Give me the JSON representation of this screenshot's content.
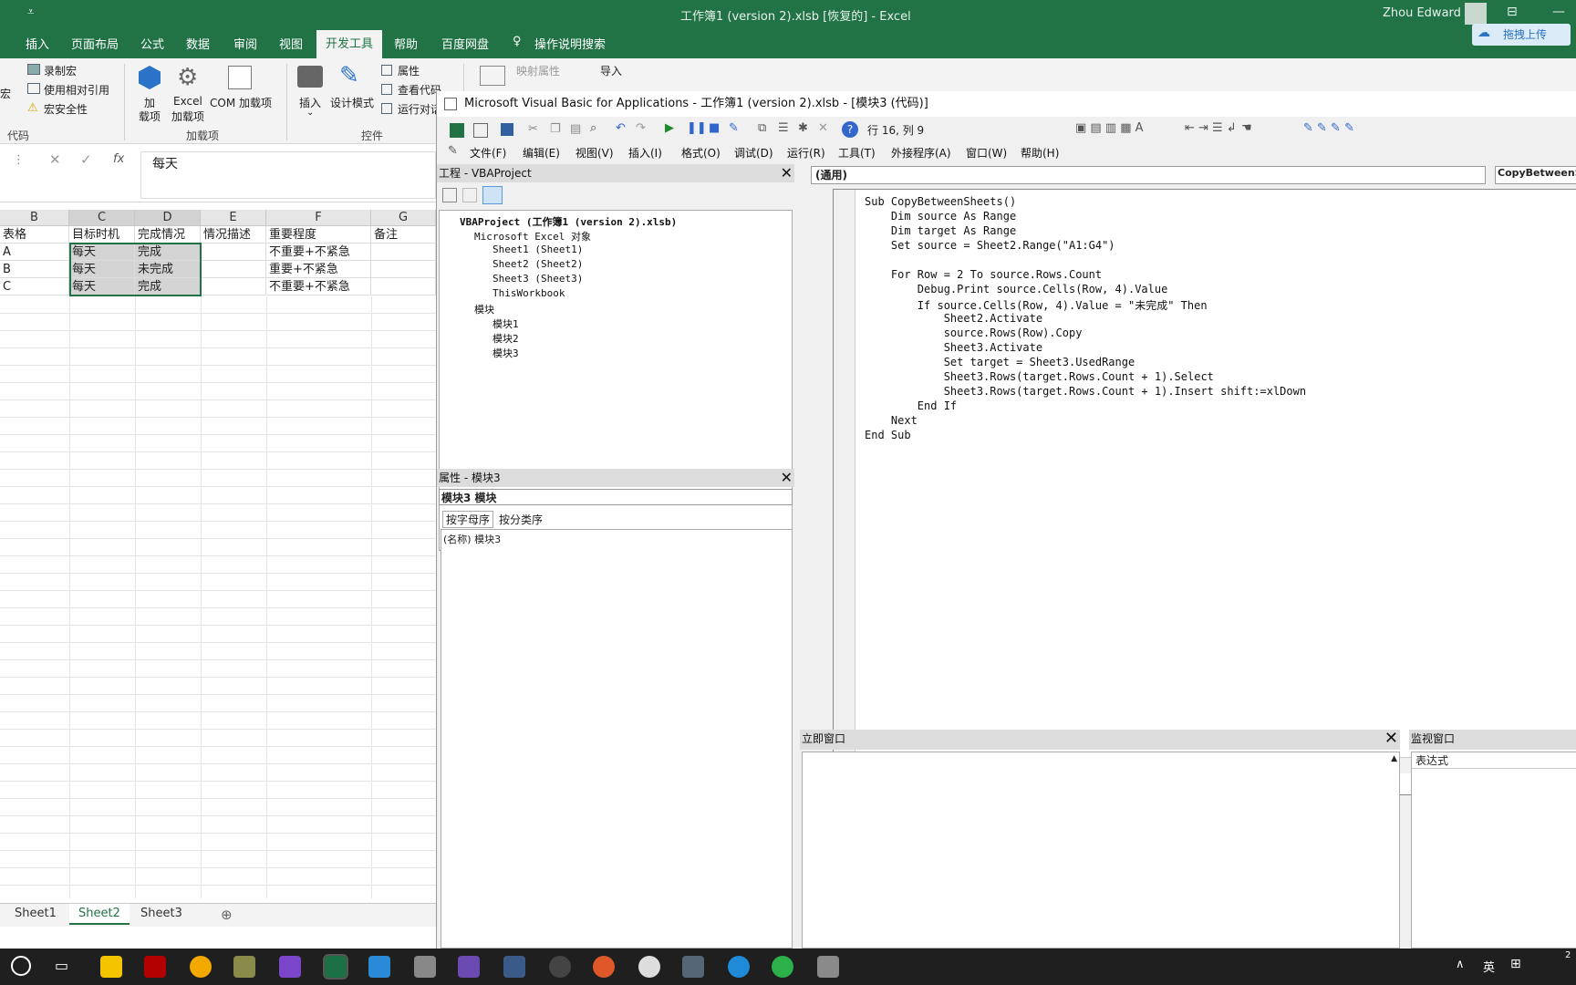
{
  "excel": {
    "title": "工作簿1 (version 2).xlsb [恢复的]  -  Excel",
    "user": "Zhou Edward",
    "upload_label": "拖拽上传",
    "tabs": [
      "插入",
      "页面布局",
      "公式",
      "数据",
      "审阅",
      "视图",
      "开发工具",
      "帮助",
      "百度网盘"
    ],
    "tell_me": "操作说明搜索",
    "ribbon": {
      "macro_record": "录制宏",
      "macro_relative": "使用相对引用",
      "macro_security": "宏安全性",
      "macro_partial": "宏",
      "group_code": "代码",
      "addin_label1": "加",
      "addin_label2": "载项",
      "excel_addin1": "Excel",
      "excel_addin2": "加载项",
      "com_addin": "COM 加载项",
      "group_addins": "加载项",
      "insert": "插入",
      "design_mode": "设计模式",
      "properties": "属性",
      "view_code": "查看代码",
      "run_dialog": "运行对话框",
      "group_controls": "控件",
      "map_props": "映射属性",
      "import": "导入"
    },
    "formula_value": "每天",
    "fx": "fx",
    "columns": [
      "B",
      "C",
      "D",
      "E",
      "F",
      "G"
    ],
    "header_row": [
      "表格",
      "目标时机",
      "完成情况",
      "情况描述",
      "重要程度",
      "备注"
    ],
    "rows": [
      [
        "A",
        "每天",
        "完成",
        "",
        "不重要+不紧急",
        ""
      ],
      [
        "B",
        "每天",
        "未完成",
        "",
        "重要+不紧急",
        ""
      ],
      [
        "C",
        "每天",
        "完成",
        "",
        "不重要+不紧急",
        ""
      ]
    ],
    "sheets": [
      "Sheet1",
      "Sheet2",
      "Sheet3"
    ]
  },
  "vba": {
    "title": "Microsoft Visual Basic for Applications - 工作簿1 (version 2).xlsb - [模块3 (代码)]",
    "position": "行 16, 列 9",
    "menu": [
      "文件(F)",
      "编辑(E)",
      "视图(V)",
      "插入(I)",
      "格式(O)",
      "调试(D)",
      "运行(R)",
      "工具(T)",
      "外接程序(A)",
      "窗口(W)",
      "帮助(H)"
    ],
    "project_title": "工程 - VBAProject",
    "tree": [
      "VBAProject (工作簿1 (version 2).xlsb)",
      "Microsoft Excel 对象",
      "Sheet1 (Sheet1)",
      "Sheet2 (Sheet2)",
      "Sheet3 (Sheet3)",
      "ThisWorkbook",
      "模块",
      "模块1",
      "模块2",
      "模块3"
    ],
    "props_title": "属性 - 模块3",
    "props_object": "模块3 模块",
    "props_tabs": [
      "按字母序",
      "按分类序"
    ],
    "props_row": "(名称) 模块3",
    "combo_general": "(通用)",
    "combo_proc": "CopyBetweenSheets",
    "code": [
      "Sub CopyBetweenSheets()",
      "    Dim source As Range",
      "    Dim target As Range",
      "    Set source = Sheet2.Range(\"A1:G4\")",
      "",
      "    For Row = 2 To source.Rows.Count",
      "        Debug.Print source.Cells(Row, 4).Value",
      "        If source.Cells(Row, 4).Value = \"未完成\" Then",
      "            Sheet2.Activate",
      "            source.Rows(Row).Copy",
      "            Sheet3.Activate",
      "            Set target = Sheet3.UsedRange",
      "            Sheet3.Rows(target.Rows.Count + 1).Select",
      "            Sheet3.Rows(target.Rows.Count + 1).Insert shift:=xlDown",
      "        End If",
      "    Next",
      "End Sub"
    ],
    "immediate_title": "立即窗口",
    "watch_title": "监视窗口",
    "watch_col": "表达式"
  },
  "taskbar": {
    "ime": "英",
    "time_partial": "2"
  },
  "colors": {
    "excel_green": "#217346",
    "taskbar": "#1f1f1f"
  }
}
